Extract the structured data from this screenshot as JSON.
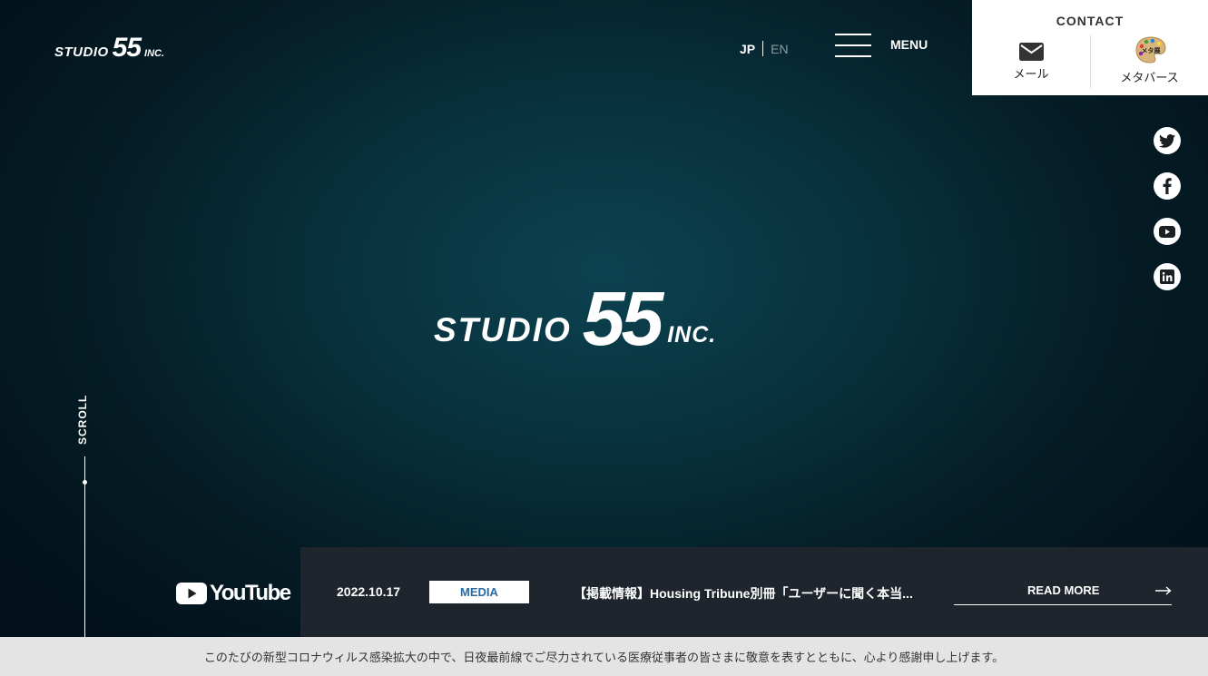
{
  "header": {
    "logo": {
      "word1": "STUDIO",
      "word2": "55",
      "word3": "INC."
    },
    "lang": {
      "jp": "JP",
      "en": "EN"
    },
    "menu_label": "MENU"
  },
  "contact": {
    "title": "CONTACT",
    "mail_label": "メール",
    "metaverse_label": "メタバース",
    "metaverse_badge": "メタ展"
  },
  "social": [
    "twitter-icon",
    "facebook-icon",
    "youtube-icon",
    "linkedin-icon"
  ],
  "hero": {
    "logo": {
      "word1": "STUDIO",
      "word2": "55",
      "word3": "INC."
    },
    "scroll_label": "SCROLL"
  },
  "youtube": {
    "label": "YouTube"
  },
  "news": {
    "date": "2022.10.17",
    "category": "MEDIA",
    "title": "【掲載情報】Housing Tribune別冊「ユーザーに聞く本当...",
    "read_more": "READ MORE"
  },
  "footer_notice": "このたびの新型コロナウィルス感染拡大の中で、日夜最前線でご尽力されている医療従事者の皆さまに敬意を表すとともに、心より感謝申し上げます。",
  "colors": {
    "accent": "#2a6aa6",
    "news_bg": "#1f252c",
    "notice_bg": "#e4e4e4"
  }
}
